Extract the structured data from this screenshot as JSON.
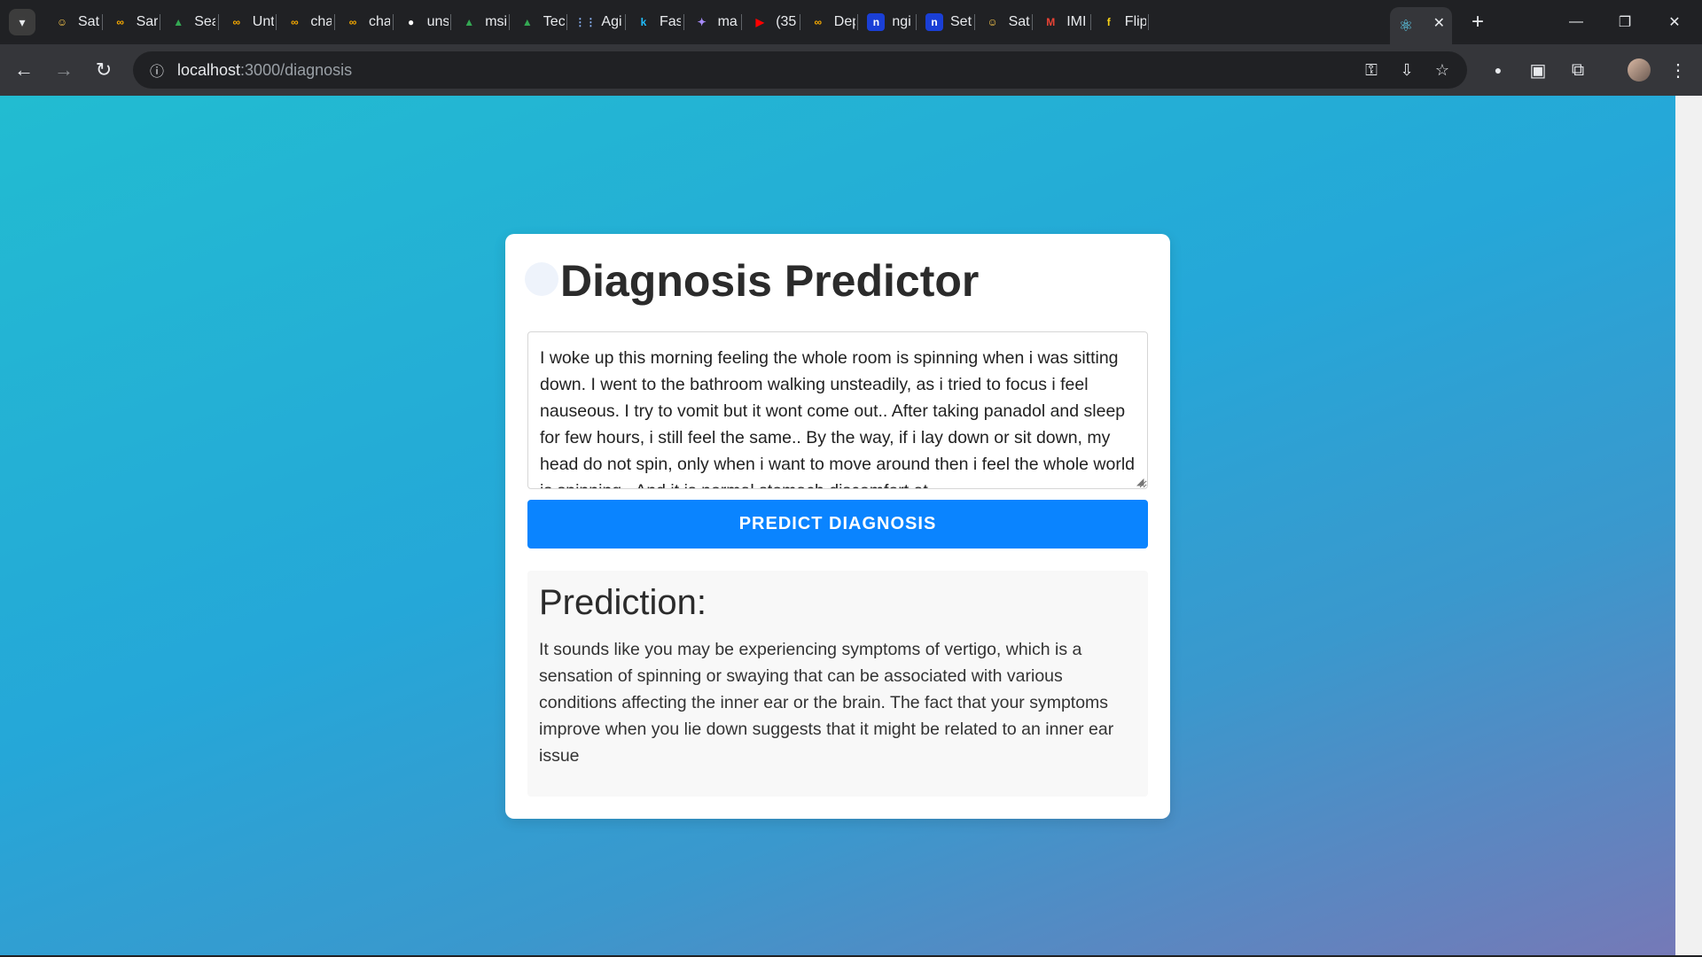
{
  "browser": {
    "tabs": [
      {
        "label": "Sat",
        "icon": "hugging-face-icon",
        "color": "#ffcc4d"
      },
      {
        "label": "Sar",
        "icon": "colab-icon",
        "color": "#f9ab00"
      },
      {
        "label": "Sea",
        "icon": "google-drive-icon",
        "color": "#34a853"
      },
      {
        "label": "Unt",
        "icon": "colab-icon",
        "color": "#f9ab00"
      },
      {
        "label": "cha",
        "icon": "colab-icon",
        "color": "#f9ab00"
      },
      {
        "label": "cha",
        "icon": "colab-icon",
        "color": "#f9ab00"
      },
      {
        "label": "uns",
        "icon": "github-icon",
        "color": "#ffffff"
      },
      {
        "label": "msi",
        "icon": "google-drive-icon",
        "color": "#34a853"
      },
      {
        "label": "Tec",
        "icon": "google-drive-icon",
        "color": "#34a853"
      },
      {
        "label": "Agi",
        "icon": "apps-grid-icon",
        "color": "#8ab4f8"
      },
      {
        "label": "Fas",
        "icon": "k-icon",
        "color": "#20beff"
      },
      {
        "label": "ma",
        "icon": "sparkle-icon",
        "color": "#a78bfa"
      },
      {
        "label": "(35",
        "icon": "youtube-icon",
        "color": "#ff0000"
      },
      {
        "label": "Dep",
        "icon": "colab-icon",
        "color": "#f9ab00"
      },
      {
        "label": "ngi",
        "icon": "n-icon",
        "color": "#1a3fd6"
      },
      {
        "label": "Set",
        "icon": "n-icon",
        "color": "#1a3fd6"
      },
      {
        "label": "Sat",
        "icon": "hugging-face-icon",
        "color": "#ffcc4d"
      },
      {
        "label": "IMI",
        "icon": "gmail-icon",
        "color": "#ea4335"
      },
      {
        "label": "Flip",
        "icon": "flipkart-icon",
        "color": "#f7d117"
      }
    ],
    "active_tab_icon": "react-icon",
    "address": {
      "host": "localhost",
      "path": ":3000/diagnosis"
    }
  },
  "app": {
    "title": "Diagnosis Predictor",
    "symptoms_text": "I woke up this morning feeling the whole room is spinning when i was sitting down. I went to the bathroom walking unsteadily, as i tried to focus i feel nauseous. I try to vomit but it wont come out.. After taking panadol and sleep for few hours, i still feel the same.. By the way, if i lay down or sit down, my head do not spin, only when i want to move around then i feel the whole world is spinning.. And it is normal stomach discomfort at",
    "button_label": "PREDICT DIAGNOSIS",
    "prediction_heading": "Prediction:",
    "prediction_text": "It sounds like you may be experiencing symptoms of vertigo, which is a sensation of spinning or swaying that can be associated with various conditions affecting the inner ear or the brain. The fact that your symptoms improve when you lie down suggests that it might be related to an inner ear issue"
  },
  "colors": {
    "button": "#0a84ff",
    "gradient_start": "#22bcd1",
    "gradient_end": "#7579b7"
  }
}
